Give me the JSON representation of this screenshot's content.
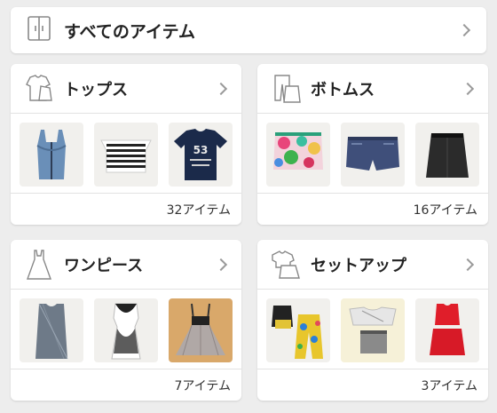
{
  "all_items": {
    "label": "すべてのアイテム"
  },
  "categories": [
    {
      "label": "トップス",
      "count_label": "32アイテム",
      "icon": "tops-icon"
    },
    {
      "label": "ボトムス",
      "count_label": "16アイテム",
      "icon": "bottoms-icon"
    },
    {
      "label": "ワンピース",
      "count_label": "7アイテム",
      "icon": "dress-icon"
    },
    {
      "label": "セットアップ",
      "count_label": "3アイテム",
      "icon": "setup-icon"
    }
  ],
  "colors": {
    "background": "#ededed",
    "card": "#ffffff",
    "text": "#222222",
    "chevron": "#9a9a9a"
  }
}
